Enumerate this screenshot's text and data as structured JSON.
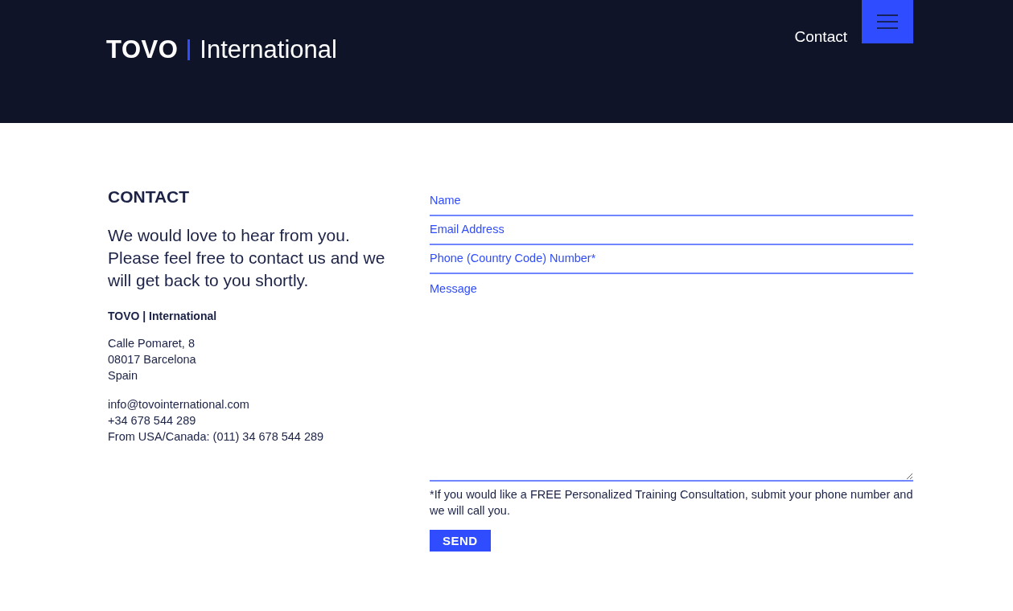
{
  "header": {
    "logo": {
      "brand": "TOVO",
      "name": "International"
    },
    "nav_link": "Contact"
  },
  "contact": {
    "heading": "CONTACT",
    "intro": "We would love to hear from you. Please feel free to contact us and we will get back to you shortly.",
    "company": "TOVO | International",
    "address": [
      "Calle Pomaret, 8",
      "08017 Barcelona",
      "Spain"
    ],
    "details": [
      "info@tovointernational.com",
      "+34 678 544 289",
      "From USA/Canada: (011) 34 678 544 289"
    ]
  },
  "form": {
    "fields": [
      {
        "kind": "input",
        "placeholder": "Name"
      },
      {
        "kind": "input",
        "placeholder": "Email Address"
      },
      {
        "kind": "input",
        "placeholder": "Phone (Country Code) Number*"
      },
      {
        "kind": "textarea",
        "placeholder": "Message"
      }
    ],
    "note": "*If you would like a FREE Personalized Training Consultation, submit your phone number and we will call you.",
    "submit": "SEND"
  }
}
